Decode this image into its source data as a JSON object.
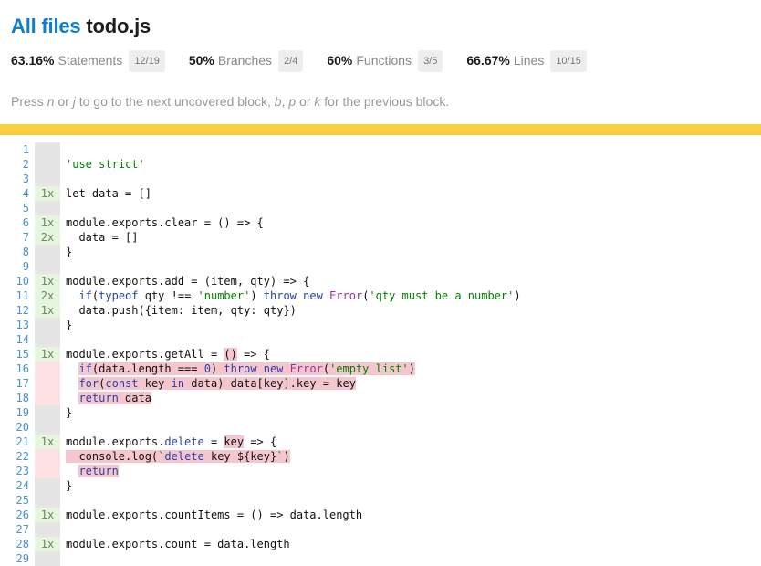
{
  "header": {
    "all_files_link": "All files",
    "file_name": "todo.js",
    "stats": [
      {
        "name": "statements",
        "pct": "63.16%",
        "label": "Statements",
        "fraction": "12/19"
      },
      {
        "name": "branches",
        "pct": "50%",
        "label": "Branches",
        "fraction": "2/4"
      },
      {
        "name": "functions",
        "pct": "60%",
        "label": "Functions",
        "fraction": "3/5"
      },
      {
        "name": "lines",
        "pct": "66.67%",
        "label": "Lines",
        "fraction": "10/15"
      }
    ],
    "hint": {
      "part1": "Press ",
      "key1": "n",
      "part2": " or ",
      "key2": "j",
      "part3": " to go to the next uncovered block, ",
      "key3": "b",
      "part4": ", ",
      "key4": "p",
      "part5": " or ",
      "key5": "k",
      "part6": " for the previous block."
    }
  },
  "colors": {
    "link": "#0b7fd4",
    "separator_yellow": "#fbce3b",
    "covered_green": "#e5f5e0",
    "uncovered_pink": "#fce1e5",
    "highlight_pink": "#f6c6ce",
    "gutter_gray": "#e5e5e5",
    "line_number_blue": "#4a90d9"
  },
  "code": {
    "line_numbers": [
      1,
      2,
      3,
      4,
      5,
      6,
      7,
      8,
      9,
      10,
      11,
      12,
      13,
      14,
      15,
      16,
      17,
      18,
      19,
      20,
      21,
      22,
      23,
      24,
      25,
      26,
      27,
      28,
      29
    ],
    "hit_counts": [
      {
        "line": 1,
        "text": "",
        "state": "blank"
      },
      {
        "line": 2,
        "text": "",
        "state": "blank"
      },
      {
        "line": 3,
        "text": "",
        "state": "blank"
      },
      {
        "line": 4,
        "text": "1x",
        "state": "covered"
      },
      {
        "line": 5,
        "text": "",
        "state": "blank"
      },
      {
        "line": 6,
        "text": "1x",
        "state": "covered"
      },
      {
        "line": 7,
        "text": "2x",
        "state": "covered"
      },
      {
        "line": 8,
        "text": "",
        "state": "blank"
      },
      {
        "line": 9,
        "text": "",
        "state": "blank"
      },
      {
        "line": 10,
        "text": "1x",
        "state": "covered"
      },
      {
        "line": 11,
        "text": "2x",
        "state": "covered"
      },
      {
        "line": 12,
        "text": "1x",
        "state": "covered"
      },
      {
        "line": 13,
        "text": "",
        "state": "blank"
      },
      {
        "line": 14,
        "text": "",
        "state": "blank"
      },
      {
        "line": 15,
        "text": "1x",
        "state": "covered"
      },
      {
        "line": 16,
        "text": "",
        "state": "uncovered"
      },
      {
        "line": 17,
        "text": "",
        "state": "uncovered"
      },
      {
        "line": 18,
        "text": "",
        "state": "uncovered"
      },
      {
        "line": 19,
        "text": "",
        "state": "blank"
      },
      {
        "line": 20,
        "text": "",
        "state": "blank"
      },
      {
        "line": 21,
        "text": "1x",
        "state": "covered"
      },
      {
        "line": 22,
        "text": "",
        "state": "uncovered"
      },
      {
        "line": 23,
        "text": "",
        "state": "uncovered"
      },
      {
        "line": 24,
        "text": "",
        "state": "blank"
      },
      {
        "line": 25,
        "text": "",
        "state": "blank"
      },
      {
        "line": 26,
        "text": "1x",
        "state": "covered"
      },
      {
        "line": 27,
        "text": "",
        "state": "blank"
      },
      {
        "line": 28,
        "text": "1x",
        "state": "covered"
      },
      {
        "line": 29,
        "text": "",
        "state": "blank"
      }
    ],
    "source_lines": [
      {
        "line": 1,
        "tokens": []
      },
      {
        "line": 2,
        "tokens": [
          {
            "t": "'use strict'",
            "c": "tok-str"
          }
        ]
      },
      {
        "line": 3,
        "tokens": []
      },
      {
        "line": 4,
        "tokens": [
          {
            "t": "let data = []",
            "c": "tok-pln"
          }
        ]
      },
      {
        "line": 5,
        "tokens": []
      },
      {
        "line": 6,
        "tokens": [
          {
            "t": "module.exports.clear = () => {",
            "c": "tok-pln"
          }
        ]
      },
      {
        "line": 7,
        "tokens": [
          {
            "t": "  data = []",
            "c": "tok-pln"
          }
        ]
      },
      {
        "line": 8,
        "tokens": [
          {
            "t": "}",
            "c": "tok-pln"
          }
        ]
      },
      {
        "line": 9,
        "tokens": []
      },
      {
        "line": 10,
        "tokens": [
          {
            "t": "module.exports.add = (item, qty) => {",
            "c": "tok-pln"
          }
        ]
      },
      {
        "line": 11,
        "tokens": [
          {
            "t": "  ",
            "c": "tok-pln"
          },
          {
            "t": "if",
            "c": "tok-kw"
          },
          {
            "t": "(",
            "c": "tok-pln"
          },
          {
            "t": "typeof",
            "c": "tok-kw"
          },
          {
            "t": " qty !== ",
            "c": "tok-pln"
          },
          {
            "t": "'number'",
            "c": "tok-str"
          },
          {
            "t": ") ",
            "c": "tok-pln"
          },
          {
            "t": "throw",
            "c": "tok-kw"
          },
          {
            "t": " ",
            "c": "tok-pln"
          },
          {
            "t": "new",
            "c": "tok-kw"
          },
          {
            "t": " ",
            "c": "tok-pln"
          },
          {
            "t": "Error",
            "c": "tok-cls"
          },
          {
            "t": "(",
            "c": "tok-pln"
          },
          {
            "t": "'qty must be a number'",
            "c": "tok-str"
          },
          {
            "t": ")",
            "c": "tok-pln"
          }
        ]
      },
      {
        "line": 12,
        "tokens": [
          {
            "t": "  data.push({item: item, qty: qty})",
            "c": "tok-pln"
          }
        ]
      },
      {
        "line": 13,
        "tokens": [
          {
            "t": "}",
            "c": "tok-pln"
          }
        ]
      },
      {
        "line": 14,
        "tokens": []
      },
      {
        "line": 15,
        "tokens": [
          {
            "t": "module.exports.getAll = ",
            "c": "tok-pln"
          },
          {
            "t": "()",
            "c": "tok-pln",
            "hl": "fstat-no"
          },
          {
            "t": " => {",
            "c": "tok-pln"
          }
        ]
      },
      {
        "line": 16,
        "tokens": [
          {
            "t": "  ",
            "c": "tok-pln"
          },
          {
            "t": "if",
            "c": "tok-kw",
            "hl": "cstat-no"
          },
          {
            "t": "(data.length === ",
            "c": "tok-pln",
            "hl": "cstat-no"
          },
          {
            "t": "0",
            "c": "tok-num",
            "hl": "cstat-no"
          },
          {
            "t": ") ",
            "c": "tok-pln",
            "hl": "cstat-no"
          },
          {
            "t": "throw",
            "c": "tok-kw",
            "hl": "cstat-no"
          },
          {
            "t": " ",
            "c": "tok-pln",
            "hl": "cstat-no"
          },
          {
            "t": "new",
            "c": "tok-kw",
            "hl": "cstat-no"
          },
          {
            "t": " ",
            "c": "tok-pln",
            "hl": "cstat-no"
          },
          {
            "t": "Error",
            "c": "tok-cls",
            "hl": "cstat-no"
          },
          {
            "t": "(",
            "c": "tok-pln",
            "hl": "cstat-no"
          },
          {
            "t": "'empty list'",
            "c": "tok-str",
            "hl": "cstat-no"
          },
          {
            "t": ")",
            "c": "tok-pln",
            "hl": "cstat-no"
          }
        ]
      },
      {
        "line": 17,
        "tokens": [
          {
            "t": "  ",
            "c": "tok-pln"
          },
          {
            "t": "for",
            "c": "tok-kw",
            "hl": "cstat-no"
          },
          {
            "t": "(",
            "c": "tok-pln",
            "hl": "cstat-no"
          },
          {
            "t": "const",
            "c": "tok-kw",
            "hl": "cstat-no"
          },
          {
            "t": " key ",
            "c": "tok-pln",
            "hl": "cstat-no"
          },
          {
            "t": "in",
            "c": "tok-kw",
            "hl": "cstat-no"
          },
          {
            "t": " data) data[key].key = key",
            "c": "tok-pln",
            "hl": "cstat-no"
          }
        ]
      },
      {
        "line": 18,
        "tokens": [
          {
            "t": "  ",
            "c": "tok-pln"
          },
          {
            "t": "return",
            "c": "tok-kw",
            "hl": "cstat-no"
          },
          {
            "t": " data",
            "c": "tok-pln",
            "hl": "cstat-no"
          }
        ]
      },
      {
        "line": 19,
        "tokens": [
          {
            "t": "}",
            "c": "tok-pln"
          }
        ]
      },
      {
        "line": 20,
        "tokens": []
      },
      {
        "line": 21,
        "tokens": [
          {
            "t": "module.exports.",
            "c": "tok-pln"
          },
          {
            "t": "delete",
            "c": "tok-kw"
          },
          {
            "t": " = ",
            "c": "tok-pln"
          },
          {
            "t": "key",
            "c": "tok-pln",
            "hl": "fstat-no"
          },
          {
            "t": " => {",
            "c": "tok-pln"
          }
        ]
      },
      {
        "line": 22,
        "tokens": [
          {
            "t": "  console.log(",
            "c": "tok-pln",
            "hl": "cstat-no"
          },
          {
            "t": "`",
            "c": "tok-str",
            "hl": "cstat-no"
          },
          {
            "t": "delete",
            "c": "tok-kw",
            "hl": "cstat-no"
          },
          {
            "t": " key ${key}",
            "c": "tok-pln",
            "hl": "cstat-no"
          },
          {
            "t": "`",
            "c": "tok-str",
            "hl": "cstat-no"
          },
          {
            "t": ")",
            "c": "tok-pln",
            "hl": "cstat-no"
          }
        ]
      },
      {
        "line": 23,
        "tokens": [
          {
            "t": "  ",
            "c": "tok-pln"
          },
          {
            "t": "return",
            "c": "tok-kw",
            "hl": "cstat-no"
          }
        ]
      },
      {
        "line": 24,
        "tokens": [
          {
            "t": "}",
            "c": "tok-pln"
          }
        ]
      },
      {
        "line": 25,
        "tokens": []
      },
      {
        "line": 26,
        "tokens": [
          {
            "t": "module.exports.countItems = () => data.length",
            "c": "tok-pln"
          }
        ]
      },
      {
        "line": 27,
        "tokens": []
      },
      {
        "line": 28,
        "tokens": [
          {
            "t": "module.exports.count = data.length",
            "c": "tok-pln"
          }
        ]
      },
      {
        "line": 29,
        "tokens": []
      }
    ]
  }
}
